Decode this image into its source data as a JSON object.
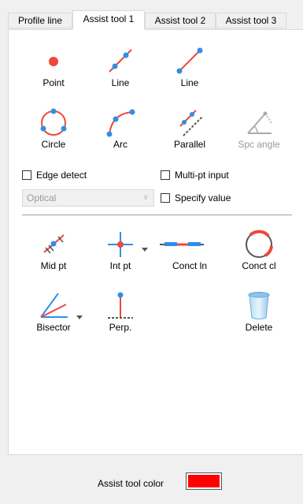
{
  "tabs": [
    {
      "label": "Profile line",
      "active": false
    },
    {
      "label": "Assist tool 1",
      "active": true
    },
    {
      "label": "Assist tool 2",
      "active": false
    },
    {
      "label": "Assist tool 3",
      "active": false
    }
  ],
  "tools": {
    "point": "Point",
    "line1": "Line",
    "line2": "Line",
    "circle": "Circle",
    "arc": "Arc",
    "parallel": "Parallel",
    "spc_angle": "Spc angle",
    "mid_pt": "Mid pt",
    "int_pt": "Int pt",
    "conct_ln": "Conct ln",
    "conct_cl": "Conct cl",
    "bisector": "Bisector",
    "perp": "Perp.",
    "delete": "Delete"
  },
  "options": {
    "edge_detect": "Edge detect",
    "multi_pt_input": "Multi-pt input",
    "specify_value": "Specify value",
    "edge_mode": "Optical"
  },
  "footer": {
    "assist_tool_color_label": "Assist tool color",
    "assist_tool_color": "#ff0000"
  },
  "colors": {
    "accent_red": "#f0463c",
    "accent_blue": "#2f8fe8"
  }
}
